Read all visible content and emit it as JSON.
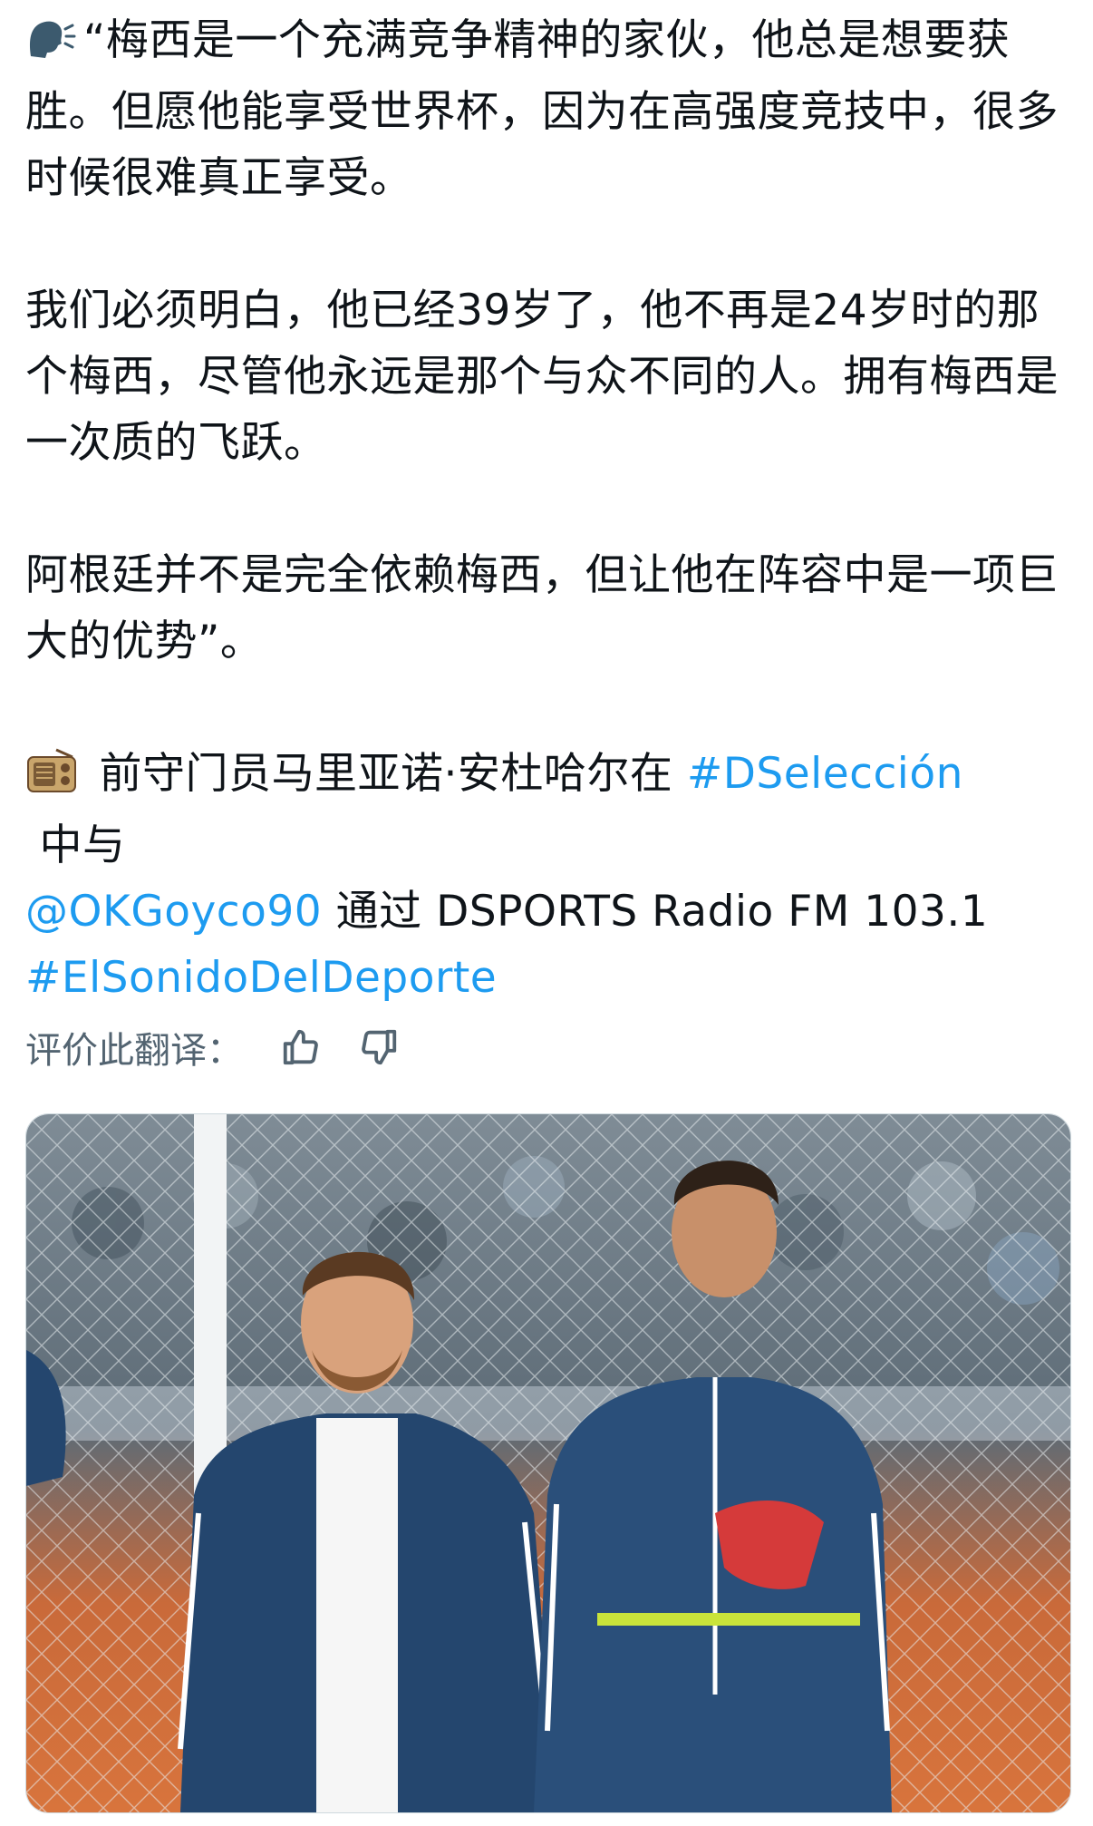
{
  "tweet": {
    "para1": "“梅西是一个充满竞争精神的家伙，他总是想要获胜。但愿他能享受世界杯，因为在高强度竞技中，很多时候很难真正享受。",
    "para2": "我们必须明白，他已经39岁了，他不再是24岁时的那个梅西，尽管他永远是那个与众不同的人。拥有梅西是一次质的飞跃。",
    "para3": "阿根廷并不是完全依赖梅西，但让他在阵容中是一项巨大的优势”。",
    "para4_text_a": " 前守门员马里亚诺·安杜哈尔在 ",
    "para4_hashtag1": "#DSelección",
    "para4_text_b": " 中与",
    "para4_mention": "@OKGoyco90",
    "para4_text_c": " 通过 DSPORTS Radio FM 103.1",
    "para4_hashtag2": "#ElSonidoDelDeporte"
  },
  "emojis": {
    "first": "speaking-head-icon",
    "second": "radio-icon"
  },
  "translation_rating": {
    "label": "评价此翻译："
  },
  "colors": {
    "link": "#1d9bf0",
    "text": "#0f1419",
    "secondary": "#536471"
  }
}
